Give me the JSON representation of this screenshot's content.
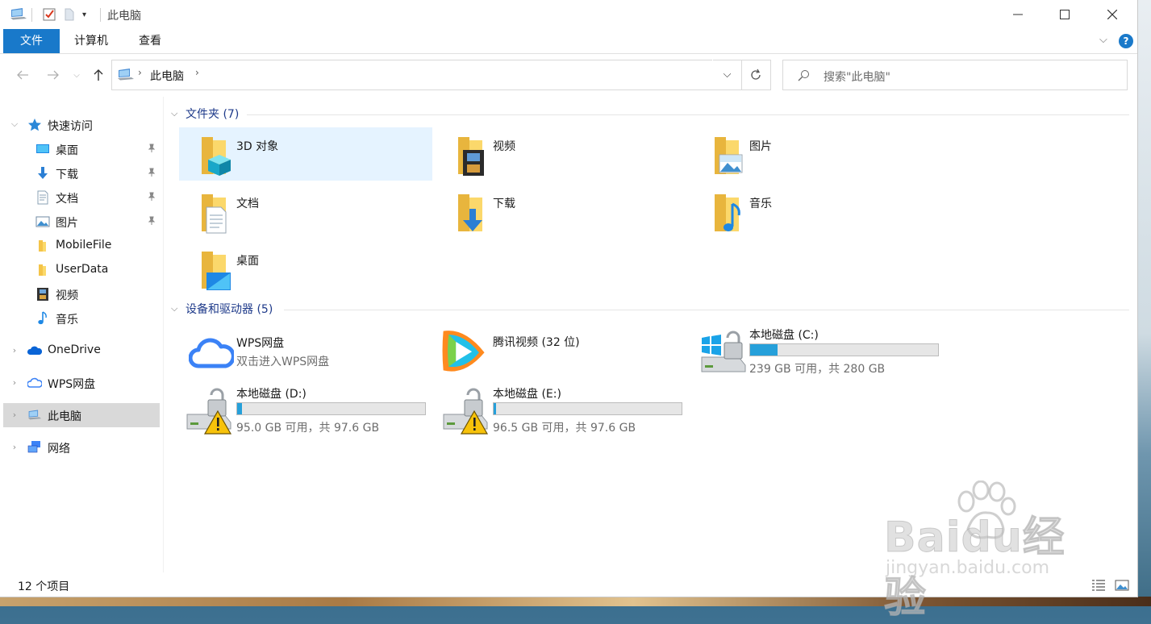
{
  "window": {
    "title": "此电脑"
  },
  "ribbon": {
    "tabs": [
      {
        "label": "文件",
        "active": true
      },
      {
        "label": "计算机",
        "active": false
      },
      {
        "label": "查看",
        "active": false
      }
    ],
    "help_icon": "help-icon",
    "accent_color": "#1979ca"
  },
  "address": {
    "segments": [
      "此电脑"
    ],
    "search_placeholder": "搜索\"此电脑\""
  },
  "nav": {
    "quick_access": "快速访问",
    "quick_items": [
      {
        "label": "桌面",
        "pinned": true
      },
      {
        "label": "下载",
        "pinned": true
      },
      {
        "label": "文档",
        "pinned": true
      },
      {
        "label": "图片",
        "pinned": true
      },
      {
        "label": "MobileFile",
        "pinned": false
      },
      {
        "label": "UserData",
        "pinned": false
      },
      {
        "label": "视频",
        "pinned": false
      },
      {
        "label": "音乐",
        "pinned": false
      }
    ],
    "onedrive": "OneDrive",
    "wps": "WPS网盘",
    "this_pc": "此电脑",
    "network": "网络"
  },
  "content": {
    "folders_header": "文件夹 (7)",
    "folders": [
      {
        "name": "3D 对象",
        "icon": "3d-objects-folder-icon",
        "selected": true
      },
      {
        "name": "视频",
        "icon": "videos-folder-icon"
      },
      {
        "name": "图片",
        "icon": "pictures-folder-icon"
      },
      {
        "name": "文档",
        "icon": "documents-folder-icon"
      },
      {
        "name": "下载",
        "icon": "downloads-folder-icon"
      },
      {
        "name": "音乐",
        "icon": "music-folder-icon"
      },
      {
        "name": "桌面",
        "icon": "desktop-folder-icon"
      }
    ],
    "devices_header": "设备和驱动器 (5)",
    "wps": {
      "name": "WPS网盘",
      "sub": "双击进入WPS网盘"
    },
    "tencent": {
      "name": "腾讯视频 (32 位)"
    },
    "drives": [
      {
        "name": "本地磁盘 (C:)",
        "sub": "239 GB 可用，共 280 GB",
        "used_fraction": 0.146,
        "warning": false
      },
      {
        "name": "本地磁盘 (D:)",
        "sub": "95.0 GB 可用，共 97.6 GB",
        "used_fraction": 0.027,
        "warning": true
      },
      {
        "name": "本地磁盘 (E:)",
        "sub": "96.5 GB 可用，共 97.6 GB",
        "used_fraction": 0.011,
        "warning": true
      }
    ],
    "bar_color": "#26a0da"
  },
  "status": {
    "count": "12 个项目"
  },
  "watermark": {
    "brand": "Baidu经验",
    "url": "jingyan.baidu.com"
  }
}
